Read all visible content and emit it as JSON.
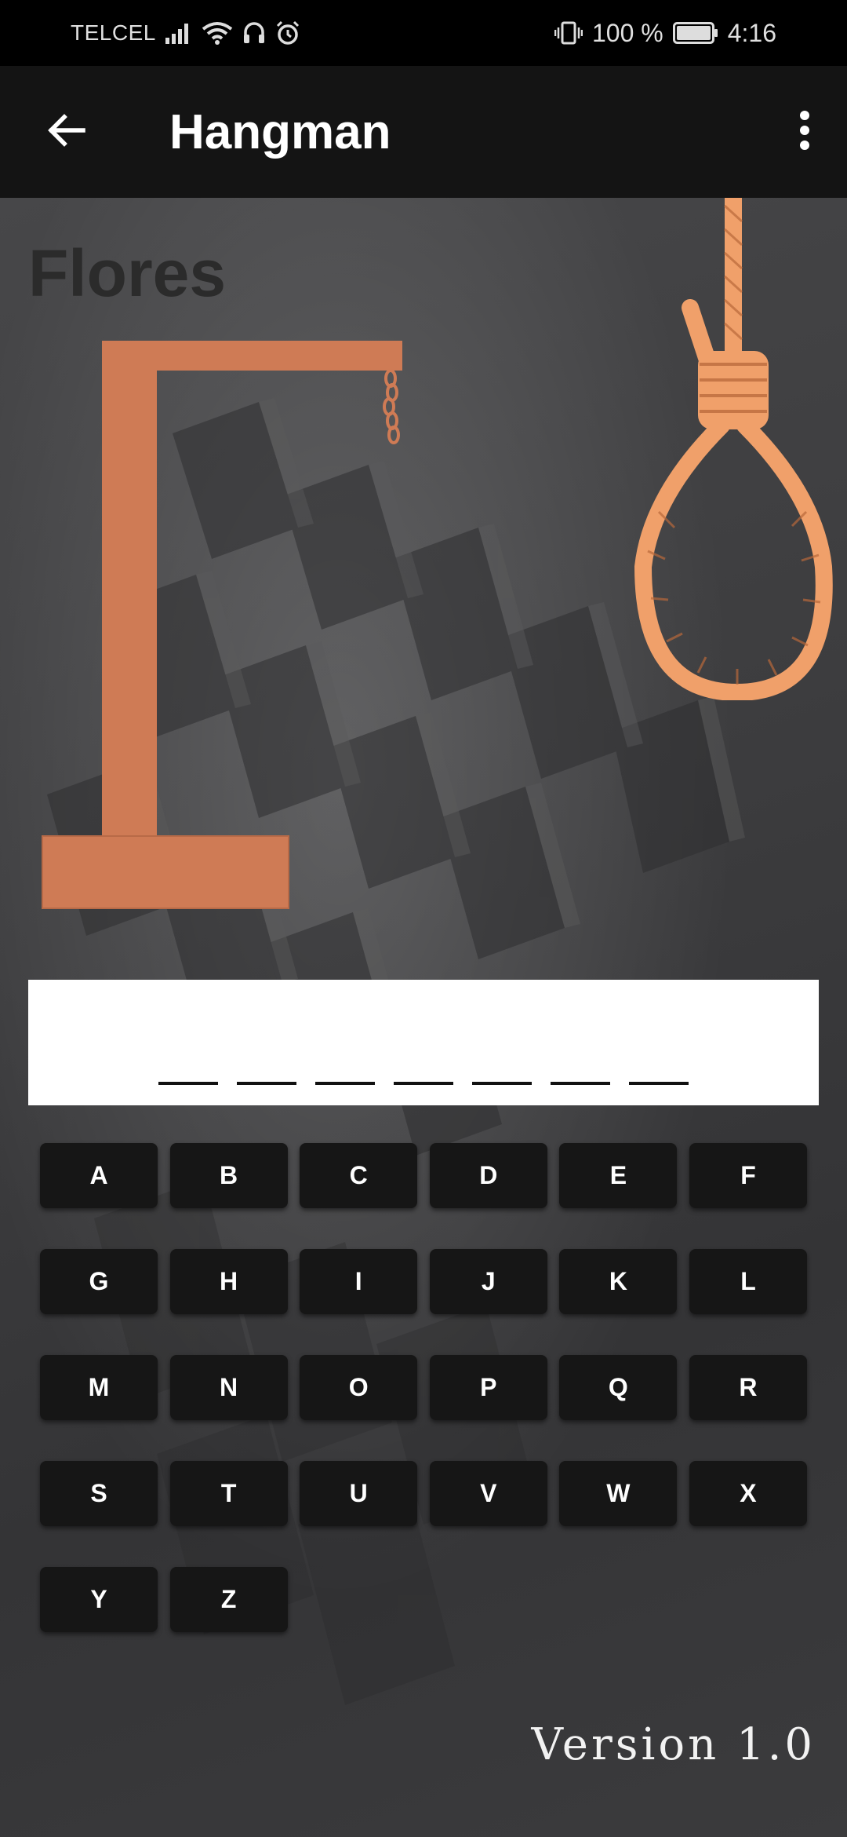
{
  "status_bar": {
    "carrier": "TELCEL",
    "battery": "100 %",
    "time": "4:16",
    "icons": [
      "signal-icon",
      "wifi-icon",
      "headphones-icon",
      "alarm-icon",
      "vibrate-icon",
      "battery-icon"
    ]
  },
  "app_bar": {
    "title": "Hangman",
    "back_icon": "arrow-left-icon",
    "menu_icon": "more-vert-icon"
  },
  "game": {
    "category": "Flores",
    "word_length": 7,
    "letters": [
      "A",
      "B",
      "C",
      "D",
      "E",
      "F",
      "G",
      "H",
      "I",
      "J",
      "K",
      "L",
      "M",
      "N",
      "O",
      "P",
      "Q",
      "R",
      "S",
      "T",
      "U",
      "V",
      "W",
      "X",
      "Y",
      "Z"
    ],
    "version": "Version 1.0"
  },
  "colors": {
    "gallows": "#cf7b55",
    "noose": "#f0a06a",
    "key_bg": "#161616",
    "app_bar": "#141414"
  }
}
